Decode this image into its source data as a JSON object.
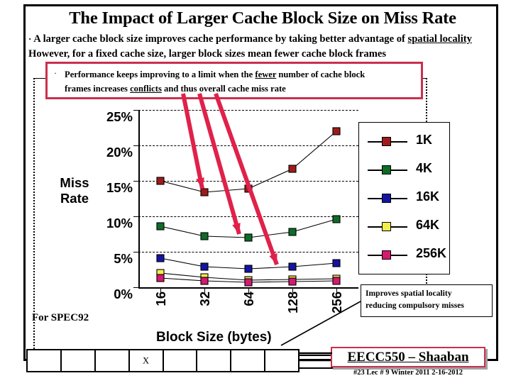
{
  "slide": {
    "title": "The Impact of Larger Cache Block Size on Miss Rate",
    "bullet_marker": "·",
    "bullet_text_part1": "A larger cache block size improves cache performance by taking better advantage of ",
    "bullet_underline1": "spatial locality",
    "bullet_text_part2": " However, for a fixed cache size, larger block sizes mean fewer cache block frames",
    "callout": {
      "bullet_marker": "·",
      "line1_a": "Performance keeps improving to a limit when the ",
      "line1_underline": "fewer",
      "line1_b": " number of cache block",
      "line2_a": "frames increases ",
      "line2_underline": "conflicts",
      "line2_b": " and thus overall cache miss rate",
      "border_color": "#c9304e"
    },
    "spec_note": "For SPEC92",
    "side_note_line1": "Improves spatial locality",
    "side_note_line2": "reducing compulsory misses",
    "block_diagram": {
      "center_label": "X",
      "cells": 8,
      "left_arrow": "◀",
      "right_arrow": "▶"
    },
    "footer": {
      "brand": "EECC550 – Shaaban",
      "meta": "#23   Lec # 9  Winter 2011  2-16-2012",
      "brand_border_color": "#c9304e"
    },
    "arrow_color": "#e0214a"
  },
  "chart_data": {
    "type": "line",
    "title": "",
    "xlabel": "Block Size (bytes)",
    "ylabel": "Miss Rate",
    "categories": [
      "16",
      "32",
      "64",
      "128",
      "256"
    ],
    "ytick_labels": [
      "0%",
      "5%",
      "10%",
      "15%",
      "20%",
      "25%"
    ],
    "ytick_values": [
      0,
      5,
      10,
      15,
      20,
      25
    ],
    "ylim": [
      0,
      25
    ],
    "grid": true,
    "legend_position": "right",
    "series": [
      {
        "name": "1K",
        "color": "#9e1b1b",
        "values": [
          15.0,
          13.4,
          13.9,
          16.7,
          22.0
        ]
      },
      {
        "name": "4K",
        "color": "#0e6b28",
        "values": [
          8.6,
          7.2,
          7.0,
          7.8,
          9.6
        ]
      },
      {
        "name": "16K",
        "color": "#1414a0",
        "values": [
          4.1,
          2.9,
          2.6,
          2.9,
          3.4
        ]
      },
      {
        "name": "64K",
        "color": "#f2ec4f",
        "values": [
          2.0,
          1.4,
          1.0,
          1.1,
          1.2
        ]
      },
      {
        "name": "256K",
        "color": "#d31a6e",
        "values": [
          1.3,
          0.9,
          0.7,
          0.8,
          0.9
        ]
      }
    ]
  }
}
